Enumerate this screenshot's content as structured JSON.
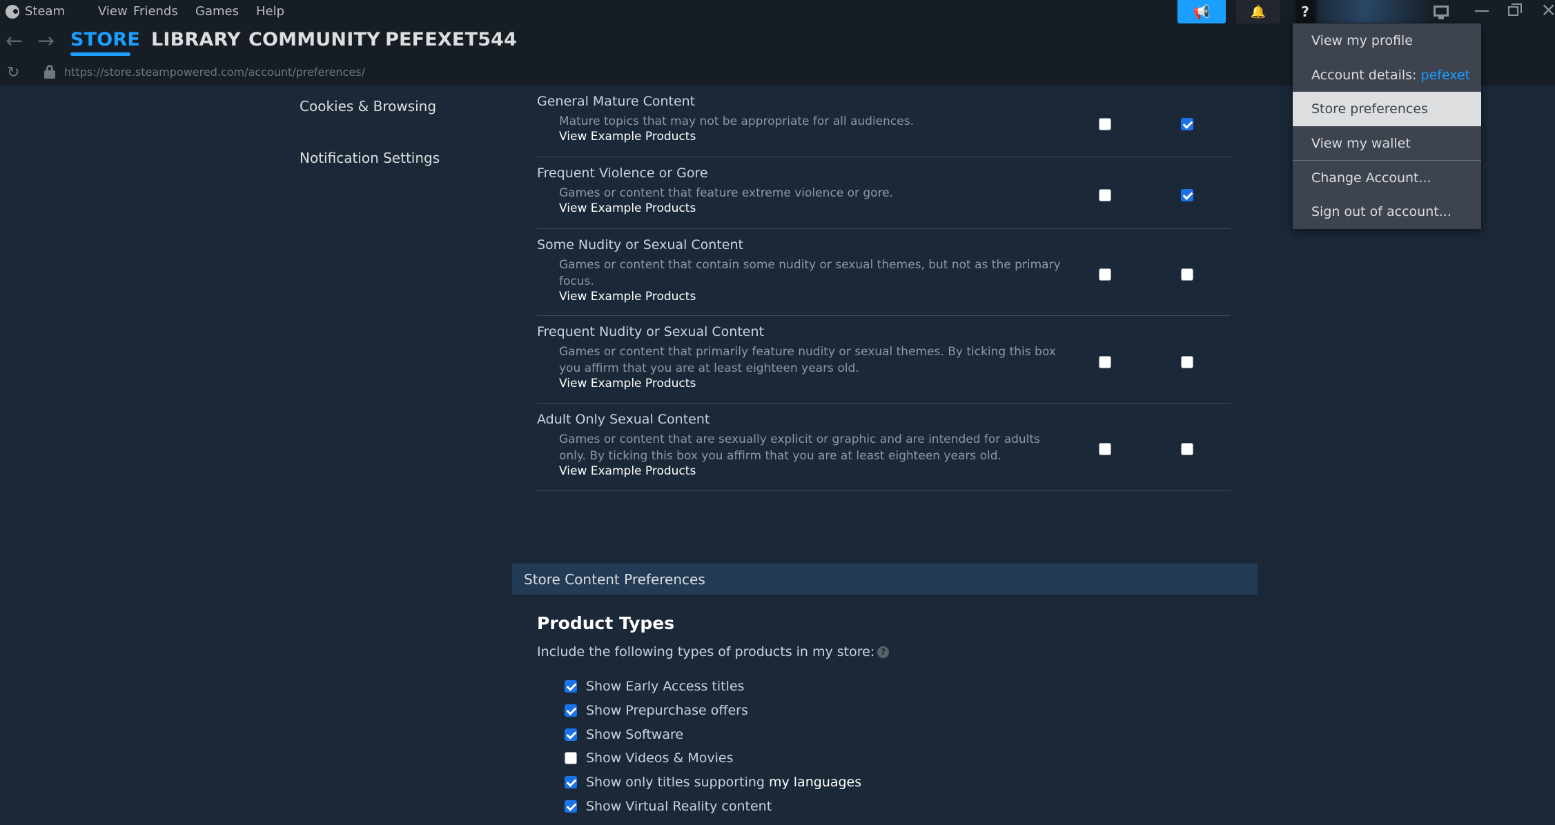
{
  "menubar": {
    "items": [
      "Steam",
      "View",
      "Friends",
      "Games",
      "Help"
    ]
  },
  "nav": {
    "tabs": [
      "STORE",
      "LIBRARY",
      "COMMUNITY",
      "PEFEXET544"
    ],
    "active_tab": "STORE",
    "url": "https://store.steampowered.com/account/preferences/"
  },
  "topbar": {
    "help_label": "?"
  },
  "sidebar": {
    "items": [
      "Cookies & Browsing",
      "Notification Settings"
    ]
  },
  "mature_content": {
    "rows": [
      {
        "title": "General Mature Content",
        "description": "Mature topics that may not be appropriate for all audiences.",
        "link": "View Example Products",
        "col1_checked": false,
        "col2_checked": true
      },
      {
        "title": "Frequent Violence or Gore",
        "description": "Games or content that feature extreme violence or gore.",
        "link": "View Example Products",
        "col1_checked": false,
        "col2_checked": true
      },
      {
        "title": "Some Nudity or Sexual Content",
        "description": "Games or content that contain some nudity or sexual themes, but not as the primary focus.",
        "link": "View Example Products",
        "col1_checked": false,
        "col2_checked": false
      },
      {
        "title": "Frequent Nudity or Sexual Content",
        "description": "Games or content that primarily feature nudity or sexual themes. By ticking this box you affirm that you are at least eighteen years old.",
        "link": "View Example Products",
        "col1_checked": false,
        "col2_checked": false
      },
      {
        "title": "Adult Only Sexual Content",
        "description": "Games or content that are sexually explicit or graphic and are intended for adults only. By ticking this box you affirm that you are at least eighteen years old.",
        "link": "View Example Products",
        "col1_checked": false,
        "col2_checked": false
      }
    ]
  },
  "store_content": {
    "section_title": "Store Content Preferences",
    "heading": "Product Types",
    "intro": "Include the following types of products in my store:",
    "help_icon": "?",
    "options": [
      {
        "label": "Show Early Access titles",
        "checked": true
      },
      {
        "label": "Show Prepurchase offers",
        "checked": true
      },
      {
        "label": "Show Software",
        "checked": true
      },
      {
        "label": "Show Videos & Movies",
        "checked": false
      },
      {
        "label": "Show only titles supporting ",
        "highlight": "my languages",
        "checked": true
      },
      {
        "label": "Show Virtual Reality content",
        "checked": true
      }
    ]
  },
  "account_menu": {
    "items": [
      {
        "label": "View my profile"
      },
      {
        "label": "Account details: ",
        "account": "pefexet"
      },
      {
        "label": "Store preferences",
        "selected": true
      },
      {
        "label": "View my wallet"
      },
      {
        "label": "Change Account..."
      },
      {
        "label": "Sign out of account..."
      }
    ]
  },
  "colors": {
    "accent": "#1a9fff",
    "background": "#1b2838",
    "titlebar": "#171d25",
    "section_header": "#233c56",
    "checkbox_checked": "#1a73e8"
  }
}
